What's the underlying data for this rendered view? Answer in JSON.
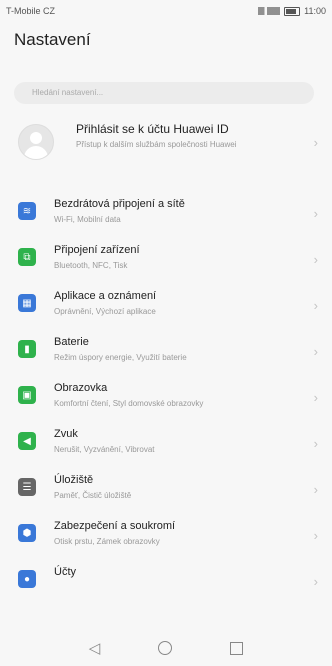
{
  "status_bar": {
    "carrier": "T-Mobile CZ",
    "time": "11:00"
  },
  "header": {
    "title": "Nastavení"
  },
  "search": {
    "placeholder": "Hledání nastavení..."
  },
  "profile": {
    "title": "Přihlásit se k účtu Huawei ID",
    "subtitle": "Přístup k dalším službám společnosti Huawei"
  },
  "colors": {
    "blue": "#3a78d8",
    "green": "#2fb24c",
    "gray": "#666666"
  },
  "items": [
    {
      "title": "Bezdrátová připojení a sítě",
      "subtitle": "Wi-Fi, Mobilní data",
      "icon": "wifi-icon",
      "color": "#3a78d8",
      "glyph": "≋"
    },
    {
      "title": "Připojení zařízení",
      "subtitle": "Bluetooth, NFC, Tisk",
      "icon": "device-connection-icon",
      "color": "#2fb24c",
      "glyph": "⧉"
    },
    {
      "title": "Aplikace a oznámení",
      "subtitle": "Oprávnění, Výchozí aplikace",
      "icon": "apps-icon",
      "color": "#3a78d8",
      "glyph": "▦"
    },
    {
      "title": "Baterie",
      "subtitle": "Režim úspory energie, Využití baterie",
      "icon": "battery-icon",
      "color": "#2fb24c",
      "glyph": "▮"
    },
    {
      "title": "Obrazovka",
      "subtitle": "Komfortní čtení, Styl domovské obrazovky",
      "icon": "display-icon",
      "color": "#2fb24c",
      "glyph": "▣"
    },
    {
      "title": "Zvuk",
      "subtitle": "Nerušit, Vyzvánění, Vibrovat",
      "icon": "sound-icon",
      "color": "#2fb24c",
      "glyph": "◀"
    },
    {
      "title": "Úložiště",
      "subtitle": "Paměť, Čistič úložiště",
      "icon": "storage-icon",
      "color": "#666666",
      "glyph": "☰"
    },
    {
      "title": "Zabezpečení a soukromí",
      "subtitle": "Otisk prstu, Zámek obrazovky",
      "icon": "security-icon",
      "color": "#3a78d8",
      "glyph": "⬢"
    },
    {
      "title": "Účty",
      "subtitle": "",
      "icon": "accounts-icon",
      "color": "#3a78d8",
      "glyph": "●"
    }
  ],
  "navigation": {
    "back": "◁",
    "home": "",
    "recent": ""
  }
}
